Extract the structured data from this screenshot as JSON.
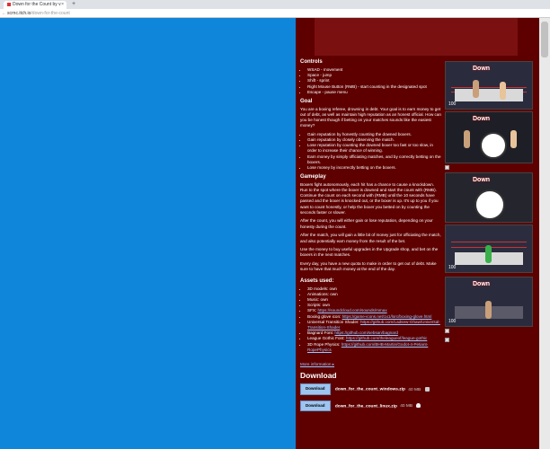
{
  "browser": {
    "tab_title": "Down for the Count by v",
    "tab_close": "×",
    "new_tab": "+",
    "nav": "←",
    "url_host": "scrnc.itch.io",
    "url_path": "/down-for-the-count"
  },
  "controls": {
    "heading": "Controls",
    "items": [
      "WSAD - movement",
      "Space - jump",
      "Shift - sprint",
      "Right Mouse Button (RMB) - start counting in the designated spot",
      "Escape - pause menu"
    ]
  },
  "goal": {
    "heading": "Goal",
    "intro": "You are a boxing referee, drowning in debt. Your goal is to earn money to get out of debt, as well as maintain high reputation as an honest official. How can you be honest though if betting on your matches sounds like the easiest money?",
    "items": [
      "Gain reputation by honestly counting the downed boxers.",
      "Gain reputation by closely observing the match.",
      "Lose reputation by counting the downed boxer too fast or too slow, in order to increase their chance of winning.",
      "Earn money by simply officiating matches, and by correctly betting on the boxers.",
      "Lose money by incorrectly betting on the boxers."
    ]
  },
  "gameplay": {
    "heading": "Gameplay",
    "p1": "Boxers fight autonomously, each hit has a chance to cause a knockdown. Run to the spot where the boxer is downed and start the count with (RMB). Continue the count on each second with (RMB) until the 10 seconds have passed and the boxer is knocked out, or the boxer is up. It's up to you if you want to count honestly, or help the boxer you betted on by counting the seconds faster or slower.",
    "p2": "After the count, you will either gain or lose reputation, depending on your honesty during the count.",
    "p3": "After the match, you will gain a little bit of money just for officiating the match, and also potentially earn money from the result of the bet.",
    "p4": "Use the money to buy useful upgrades in the Upgrade shop, and bet on the boxers in the next matches.",
    "p5": "Every day, you have a new quota to make in order to get out of debt. Make sure to have that much money at the end of the day."
  },
  "assets": {
    "heading": "Assets used:",
    "items": [
      {
        "text": "3D models: own"
      },
      {
        "text": "Animations: own"
      },
      {
        "text": "Music: own"
      },
      {
        "text": "Scripts: own"
      },
      {
        "text": "SFX: ",
        "link": "https://soundcloud.com/sounds/mmax"
      },
      {
        "text": "Boxing glove icon: ",
        "link": "https://game-icons.net/1x1/lorc/boxing-glove.html"
      },
      {
        "text": "Universal Transition Shader: ",
        "link": "https://github.com/Ladsew-Ghaw/Universal-Transition-Shader"
      },
      {
        "text": "Bagnard Font: ",
        "link": "https://github.com/sebsan/bagnard"
      },
      {
        "text": "League Gothic Font: ",
        "link": "https://github.com/theleagueof/league-gothic"
      },
      {
        "text": "3D Rope Physics: ",
        "link": "https://github.com/BHB-Martin/Godot-4-Petiant-RopePhysics"
      }
    ]
  },
  "more_info": "More information ▸",
  "download": {
    "heading": "Download",
    "button_label": "Download",
    "files": [
      {
        "name": "down_for_the_count_windows.zip",
        "size": "40 MB",
        "os": "windows-icon"
      },
      {
        "name": "down_for_the_count_linux.zip",
        "size": "40 MB",
        "os": "linux-icon"
      }
    ]
  },
  "screenshots": {
    "game_title": "Down",
    "hud_values": [
      "100",
      "100",
      "100",
      "100"
    ]
  }
}
